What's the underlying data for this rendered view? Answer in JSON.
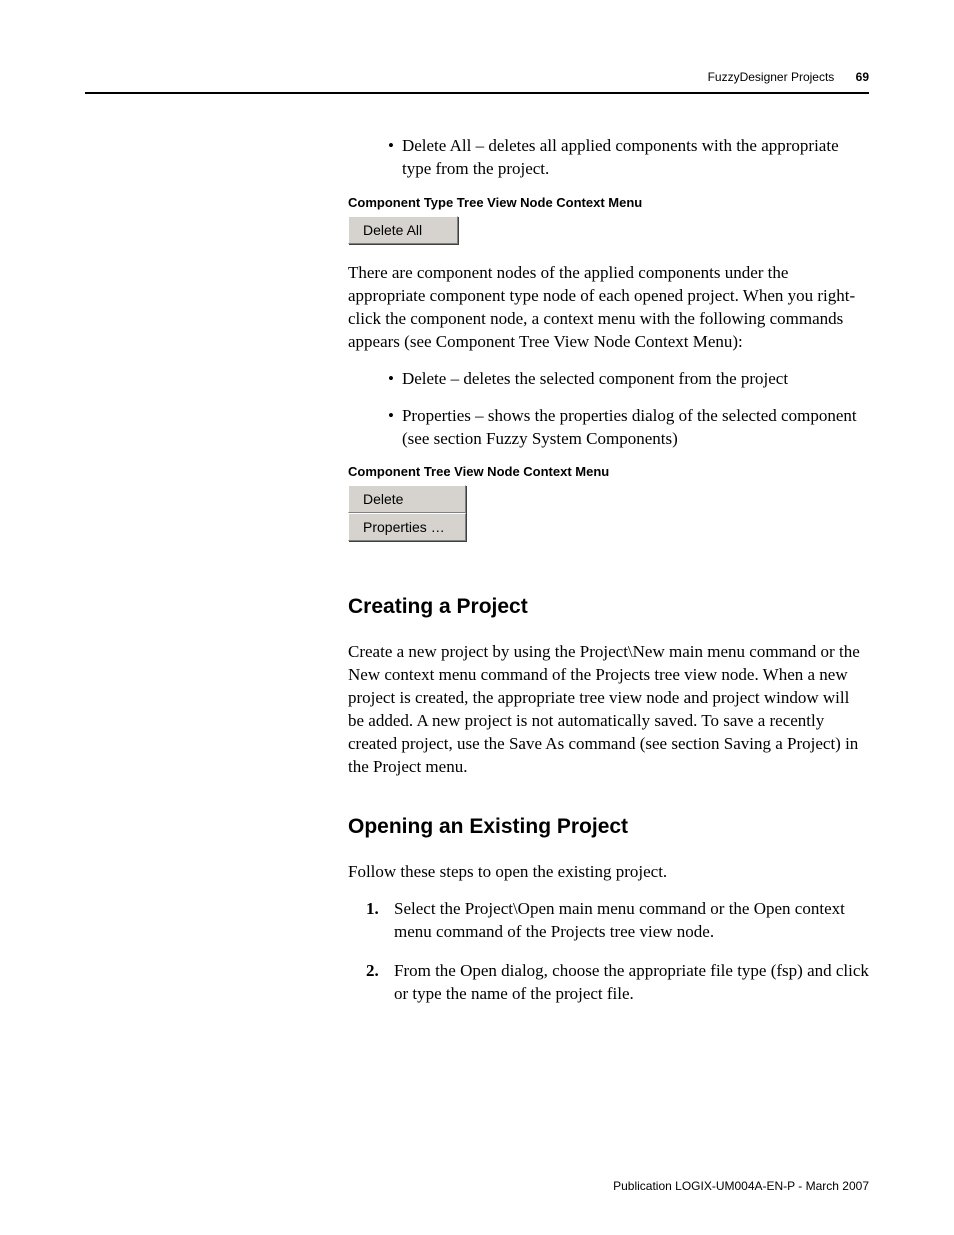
{
  "header": {
    "title": "FuzzyDesigner Projects",
    "page": "69"
  },
  "bullets_top": {
    "item1": "Delete All – deletes all applied components with the appropriate type from the project."
  },
  "caption1": "Component Type Tree View Node Context Menu",
  "menu1": {
    "item1": "Delete All"
  },
  "para1": "There are component nodes of the applied components under the appropriate component type node of each opened project. When you right-click the component node, a context menu with the following commands appears (see Component Tree View Node Context Menu):",
  "bullets2": {
    "item1": "Delete – deletes the selected component from the project",
    "item2": "Properties – shows the properties dialog of the selected component (see section Fuzzy System Components)"
  },
  "caption2": "Component Tree View Node Context Menu",
  "menu2": {
    "item1": "Delete",
    "item2": "Properties …"
  },
  "section1": {
    "heading": "Creating a Project",
    "para": "Create a new project by using the Project\\New main menu command or the New context menu command of the Projects tree view node. When a new project is created, the appropriate tree view node and project window will be added. A new project is not automatically saved. To save a recently created project, use the Save As command (see section Saving a Project) in the Project menu."
  },
  "section2": {
    "heading": "Opening an Existing Project",
    "intro": "Follow these steps to open the existing project.",
    "steps": {
      "s1": "Select the Project\\Open main menu command or the Open context menu command of the Projects tree view node.",
      "s2": "From the Open dialog, choose the appropriate file type (fsp) and click or type the name of the project file."
    }
  },
  "footer": "Publication LOGIX-UM004A-EN-P - March 2007"
}
